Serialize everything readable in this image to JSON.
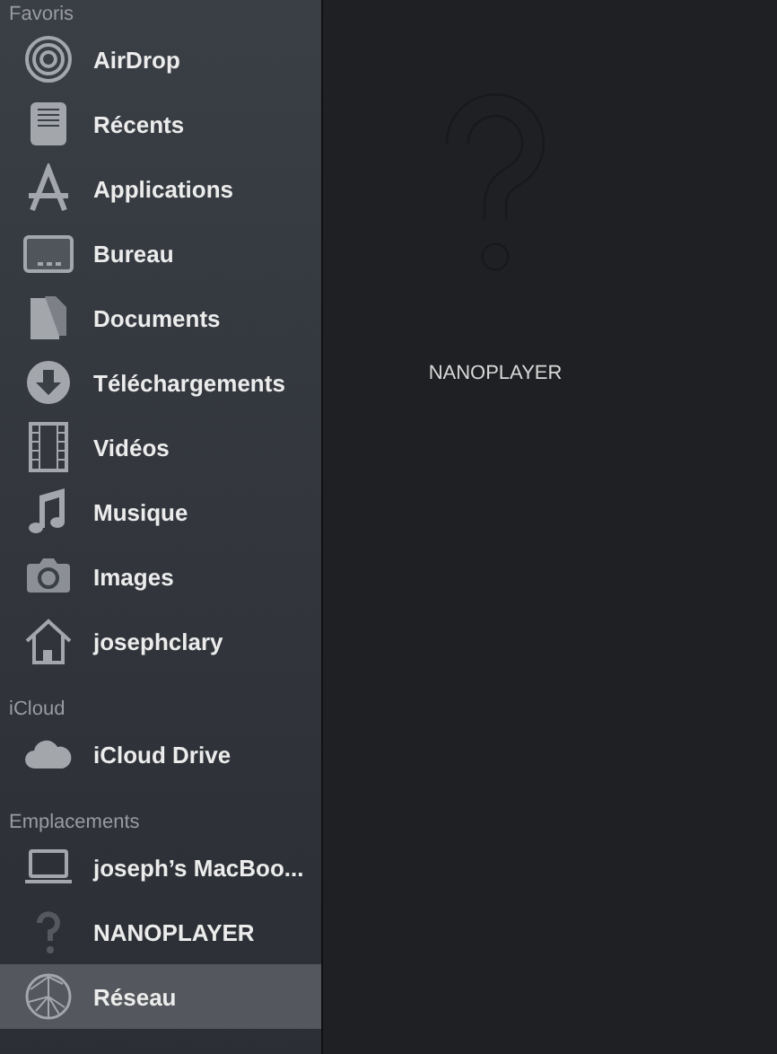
{
  "sidebar": {
    "sections": [
      {
        "title": "Favoris",
        "items": [
          {
            "label": "AirDrop",
            "kind": "airdrop",
            "selected": false
          },
          {
            "label": "Récents",
            "kind": "recents",
            "selected": false
          },
          {
            "label": "Applications",
            "kind": "applications",
            "selected": false
          },
          {
            "label": "Bureau",
            "kind": "desktop",
            "selected": false
          },
          {
            "label": "Documents",
            "kind": "documents",
            "selected": false
          },
          {
            "label": "Téléchargements",
            "kind": "downloads",
            "selected": false
          },
          {
            "label": "Vidéos",
            "kind": "movies",
            "selected": false
          },
          {
            "label": "Musique",
            "kind": "music",
            "selected": false
          },
          {
            "label": "Images",
            "kind": "pictures",
            "selected": false
          },
          {
            "label": "josephclary",
            "kind": "home",
            "selected": false
          }
        ]
      },
      {
        "title": "iCloud",
        "items": [
          {
            "label": "iCloud Drive",
            "kind": "cloud",
            "selected": false
          }
        ]
      },
      {
        "title": "Emplacements",
        "items": [
          {
            "label": "joseph’s MacBoo...",
            "kind": "laptop",
            "selected": false
          },
          {
            "label": "NANOPLAYER",
            "kind": "unknown",
            "selected": false
          },
          {
            "label": "Réseau",
            "kind": "network",
            "selected": true
          }
        ]
      }
    ]
  },
  "content": {
    "items": [
      {
        "label": "NANOPLAYER",
        "kind": "unknown"
      }
    ]
  }
}
